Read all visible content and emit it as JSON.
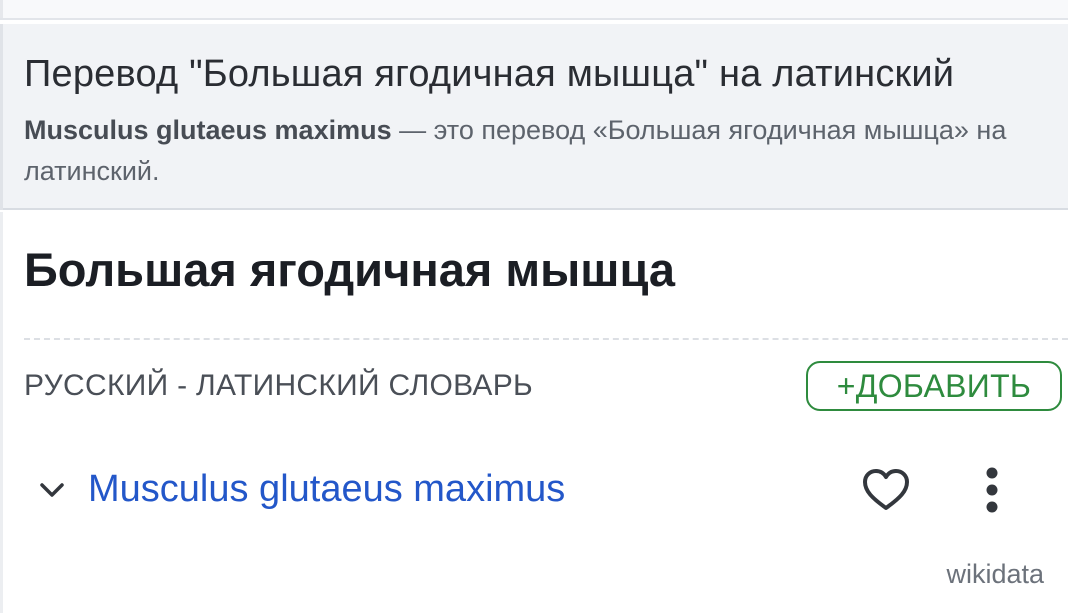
{
  "summary": {
    "title": "Перевод \"Большая ягодичная мышца\" на латинский",
    "desc_term": "Musculus glutaeus maximus",
    "desc_rest": " — это перевод «Большая ягодичная мышца» на латинский."
  },
  "entry": {
    "headword": "Большая ягодичная мышца",
    "dictionary_label": "РУССКИЙ - ЛАТИНСКИЙ СЛОВАРЬ",
    "add_button_label": "+ДОБАВИТЬ"
  },
  "translations": [
    {
      "text": "Musculus glutaeus maximus",
      "source": "wikidata",
      "icons": [
        "chevron-down-icon",
        "heart-icon",
        "more-vertical-icon"
      ]
    }
  ],
  "colors": {
    "accent_green": "#2e8b3e",
    "link_blue": "#2357c9",
    "summary_bg": "#f1f3f6"
  }
}
